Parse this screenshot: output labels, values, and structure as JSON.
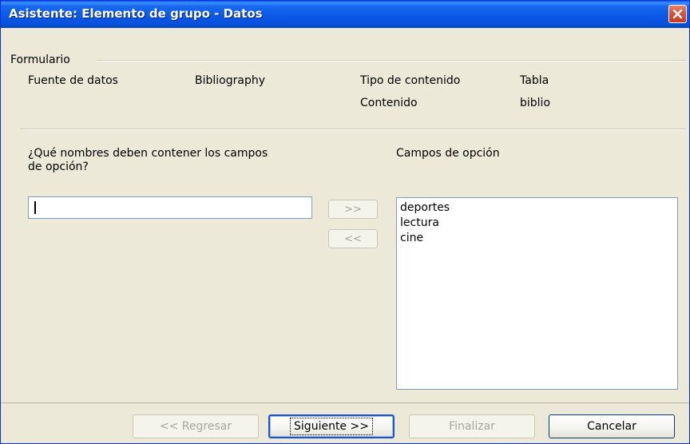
{
  "window": {
    "title": "Asistente: Elemento de grupo - Datos"
  },
  "form_section": {
    "group_label": "Formulario",
    "data_source_label": "Fuente de datos",
    "data_source_value": "Bibliography",
    "content_type_label": "Tipo de contenido",
    "content_type_value": "Tabla",
    "content_label": "Contenido",
    "content_value": "biblio"
  },
  "names_section": {
    "question_line1": "¿Qué nombres deben contener los campos",
    "question_line2": "de opción?",
    "name_input_value": "",
    "add_button": ">>",
    "remove_button": "<<",
    "option_fields_label": "Campos de opción",
    "option_fields": [
      "deportes",
      "lectura",
      "cine"
    ]
  },
  "footer": {
    "back_button": "<< Regresar",
    "next_button": "Siguiente >>",
    "finish_button": "Finalizar",
    "cancel_button": "Cancelar"
  },
  "colors": {
    "titlebar": "#0a58e6",
    "close_button": "#d9553a",
    "dialog_bg": "#ece9d8",
    "disabled_text": "#a7a69a"
  },
  "icons": {
    "close": "close-icon"
  }
}
